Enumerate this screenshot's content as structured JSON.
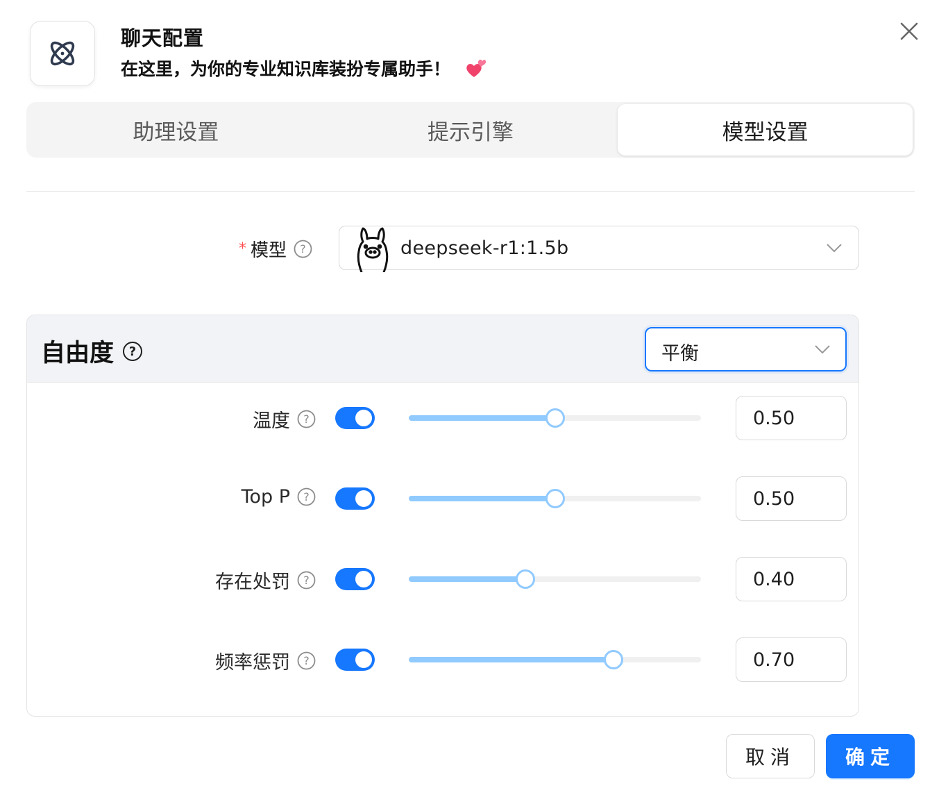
{
  "header": {
    "title": "聊天配置",
    "subtitle": "在这里，为你的专业知识库装扮专属助手！",
    "app_icon": "atom-icon",
    "decoration_icon": "two-hearts-icon",
    "close_icon": "close-icon"
  },
  "tabs": [
    {
      "label": "助理设置",
      "active": false
    },
    {
      "label": "提示引擎",
      "active": false
    },
    {
      "label": "模型设置",
      "active": true
    }
  ],
  "model": {
    "required_mark": "*",
    "label": "模型",
    "value": "deepseek-r1:1.5b",
    "icon": "llama-icon"
  },
  "freedom": {
    "title": "自由度",
    "preset": "平衡",
    "params": [
      {
        "label": "温度",
        "enabled": true,
        "value": "0.50",
        "fraction": 0.5
      },
      {
        "label": "Top P",
        "enabled": true,
        "value": "0.50",
        "fraction": 0.5
      },
      {
        "label": "存在处罚",
        "enabled": true,
        "value": "0.40",
        "fraction": 0.4
      },
      {
        "label": "频率惩罚",
        "enabled": true,
        "value": "0.70",
        "fraction": 0.7
      }
    ]
  },
  "footer": {
    "cancel_label": "取消",
    "ok_label": "确定"
  },
  "colors": {
    "accent": "#1677ff",
    "slider_track": "#91caff",
    "required": "#ff4d4f"
  }
}
